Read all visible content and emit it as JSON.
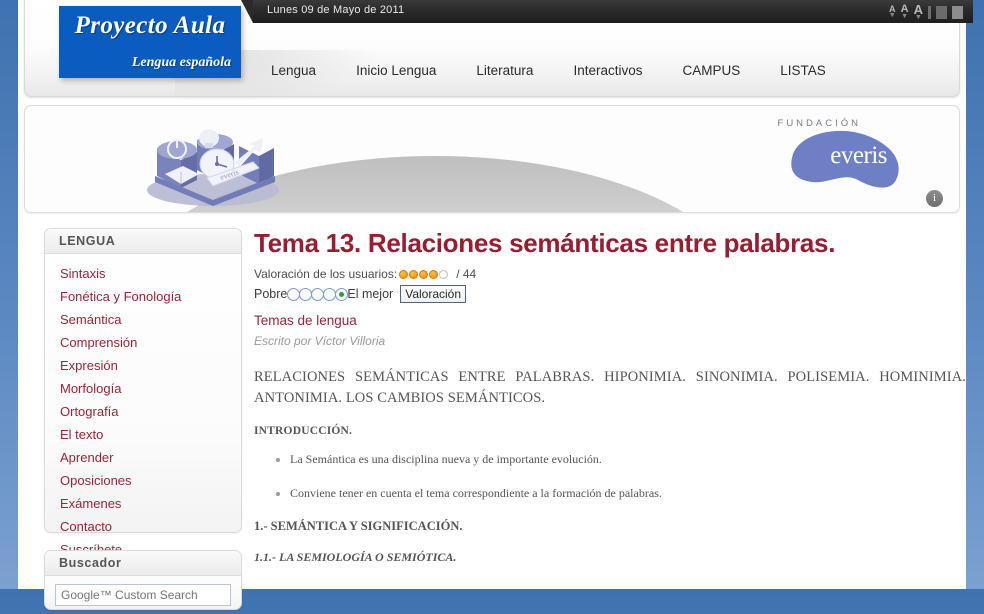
{
  "header": {
    "logo_title": "Proyecto Aula",
    "logo_subtitle": "Lengua española",
    "date": "Lunes 09 de Mayo de 2011",
    "tools": {
      "decrease_label": "A",
      "normal_label": "A",
      "increase_label": "A"
    },
    "nav": [
      {
        "label": "Lengua"
      },
      {
        "label": "Inicio Lengua"
      },
      {
        "label": "Literatura"
      },
      {
        "label": "Interactivos"
      },
      {
        "label": "CAMPUS"
      },
      {
        "label": "LISTAS"
      }
    ]
  },
  "banner": {
    "foundation_label": "FUNDACIÓN",
    "brand": "everis",
    "info_glyph": "i"
  },
  "sidebar": {
    "lengua": {
      "title": "LENGUA",
      "items": [
        {
          "label": "Sintaxis"
        },
        {
          "label": "Fonética y Fonología"
        },
        {
          "label": "Semántica"
        },
        {
          "label": "Comprensión"
        },
        {
          "label": "Expresión"
        },
        {
          "label": "Morfología"
        },
        {
          "label": "Ortografía"
        },
        {
          "label": "El texto"
        },
        {
          "label": "Aprender"
        },
        {
          "label": "Oposiciones"
        },
        {
          "label": "Exámenes"
        },
        {
          "label": "Contacto"
        },
        {
          "label": "Suscríbete"
        }
      ]
    },
    "buscador": {
      "title": "Buscador",
      "search_value": "",
      "search_placeholder": "Google™ Custom Search"
    }
  },
  "article": {
    "title": "Tema 13. Relaciones semánticas entre palabras.",
    "rating": {
      "label": "Valoración de los usuarios:",
      "filled": 4,
      "total_stars": 5,
      "count_text": "/ 44",
      "poor_label": "Pobre",
      "best_label": "El mejor",
      "selected_index": 5,
      "options": 5,
      "vote_button": "Valoración"
    },
    "category_link": "Temas de lengua",
    "byline": "Escrito por Víctor Villoria",
    "lead": "RELACIONES SEMÁNTICAS ENTRE PALABRAS. HIPONIMIA. SINONIMIA. POLISEMIA. HOMINIMIA. ANTONIMIA. LOS CAMBIOS SEMÁNTICOS.",
    "intro_heading": "INTRODUCCIÓN.",
    "bullets": [
      {
        "text": "La Semántica es una disciplina nueva y de importante evolución."
      },
      {
        "text": "Conviene tener en cuenta el tema correspondiente a la formación de palabras."
      }
    ],
    "section_heading": "1.- SEMÁNTICA Y SIGNIFICACIÓN.",
    "subsection_heading": "1.1.- LA SEMIOLOGÍA O SEMIÓTICA."
  },
  "colors": {
    "brand_blue": "#0a5cc0",
    "accent_red": "#9b1b30",
    "link_red": "#9b2335",
    "page_bg": "#3f72b0",
    "everis_blue": "#6f7fc6"
  }
}
